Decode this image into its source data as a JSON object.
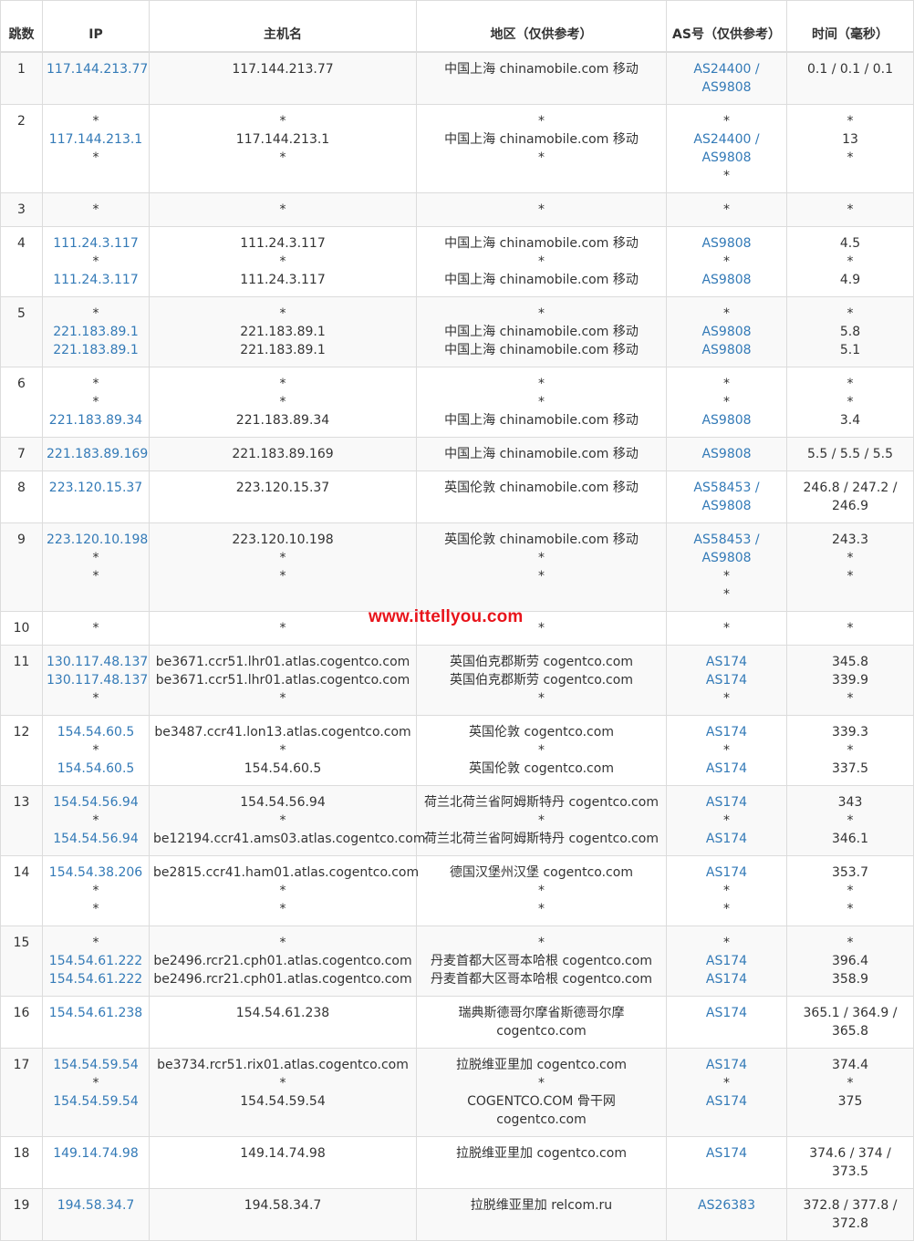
{
  "headers": {
    "hop": "跳数",
    "ip": "IP",
    "host": "主机名",
    "region": "地区（仅供参考）",
    "asn": "AS号（仅供参考）",
    "time": "时间（毫秒）"
  },
  "watermark": "www.ittellyou.com",
  "rows": [
    {
      "hop": "1",
      "ip": [
        "117.144.213.77"
      ],
      "host": [
        "117.144.213.77"
      ],
      "region": [
        "中国上海 chinamobile.com 移动"
      ],
      "asn": [
        "AS24400 /",
        "AS9808"
      ],
      "time": [
        "0.1 / 0.1 / 0.1"
      ]
    },
    {
      "hop": "2",
      "ip": [
        "*",
        "117.144.213.1",
        "*"
      ],
      "host": [
        "*",
        "117.144.213.1",
        "*"
      ],
      "region": [
        "*",
        "中国上海 chinamobile.com 移动",
        "*"
      ],
      "asn": [
        "*",
        "AS24400 /",
        "AS9808",
        "*"
      ],
      "time": [
        "*",
        "13",
        "*"
      ]
    },
    {
      "hop": "3",
      "ip": [
        "*"
      ],
      "host": [
        "*"
      ],
      "region": [
        "*"
      ],
      "asn": [
        "*"
      ],
      "time": [
        "*"
      ]
    },
    {
      "hop": "4",
      "ip": [
        "111.24.3.117",
        "*",
        "111.24.3.117"
      ],
      "host": [
        "111.24.3.117",
        "*",
        "111.24.3.117"
      ],
      "region": [
        "中国上海 chinamobile.com 移动",
        "*",
        "中国上海 chinamobile.com 移动"
      ],
      "asn": [
        "AS9808",
        "*",
        "AS9808"
      ],
      "time": [
        "4.5",
        "*",
        "4.9"
      ]
    },
    {
      "hop": "5",
      "ip": [
        "*",
        "221.183.89.1",
        "221.183.89.1"
      ],
      "host": [
        "*",
        "221.183.89.1",
        "221.183.89.1"
      ],
      "region": [
        "*",
        "中国上海 chinamobile.com 移动",
        "中国上海 chinamobile.com 移动"
      ],
      "asn": [
        "*",
        "AS9808",
        "AS9808"
      ],
      "time": [
        "*",
        "5.8",
        "5.1"
      ]
    },
    {
      "hop": "6",
      "ip": [
        "*",
        "*",
        "221.183.89.34"
      ],
      "host": [
        "*",
        "*",
        "221.183.89.34"
      ],
      "region": [
        "*",
        "*",
        "中国上海 chinamobile.com 移动"
      ],
      "asn": [
        "*",
        "*",
        "AS9808"
      ],
      "time": [
        "*",
        "*",
        "3.4"
      ]
    },
    {
      "hop": "7",
      "ip": [
        "221.183.89.169"
      ],
      "host": [
        "221.183.89.169"
      ],
      "region": [
        "中国上海 chinamobile.com 移动"
      ],
      "asn": [
        "AS9808"
      ],
      "time": [
        "5.5 / 5.5 / 5.5"
      ]
    },
    {
      "hop": "8",
      "ip": [
        "223.120.15.37"
      ],
      "host": [
        "223.120.15.37"
      ],
      "region": [
        "英国伦敦 chinamobile.com 移动"
      ],
      "asn": [
        "AS58453 /",
        "AS9808"
      ],
      "time": [
        "246.8 / 247.2 /",
        "246.9"
      ]
    },
    {
      "hop": "9",
      "ip": [
        "223.120.10.198",
        "*",
        "*"
      ],
      "host": [
        "223.120.10.198",
        "*",
        "*"
      ],
      "region": [
        "英国伦敦 chinamobile.com 移动",
        "*",
        "*"
      ],
      "asn": [
        "AS58453 /",
        "AS9808",
        "*",
        "*"
      ],
      "time": [
        "243.3",
        "*",
        "*"
      ]
    },
    {
      "hop": "10",
      "ip": [
        "*"
      ],
      "host": [
        "*"
      ],
      "region": [
        "*"
      ],
      "asn": [
        "*"
      ],
      "time": [
        "*"
      ]
    },
    {
      "hop": "11",
      "ip": [
        "130.117.48.137",
        "130.117.48.137",
        "*"
      ],
      "host": [
        "be3671.ccr51.lhr01.atlas.cogentco.com",
        "be3671.ccr51.lhr01.atlas.cogentco.com",
        "*"
      ],
      "region": [
        "英国伯克郡斯劳 cogentco.com",
        "英国伯克郡斯劳 cogentco.com",
        "*"
      ],
      "asn": [
        "AS174",
        "AS174",
        "*"
      ],
      "time": [
        "345.8",
        "339.9",
        "*"
      ]
    },
    {
      "hop": "12",
      "ip": [
        "154.54.60.5",
        "*",
        "154.54.60.5"
      ],
      "host": [
        "be3487.ccr41.lon13.atlas.cogentco.com",
        "*",
        "154.54.60.5"
      ],
      "region": [
        "英国伦敦 cogentco.com",
        "*",
        "英国伦敦 cogentco.com"
      ],
      "asn": [
        "AS174",
        "*",
        "AS174"
      ],
      "time": [
        "339.3",
        "*",
        "337.5"
      ]
    },
    {
      "hop": "13",
      "ip": [
        "154.54.56.94",
        "*",
        "154.54.56.94"
      ],
      "host": [
        "154.54.56.94",
        "*",
        "be12194.ccr41.ams03.atlas.cogentco.com"
      ],
      "region": [
        "荷兰北荷兰省阿姆斯特丹 cogentco.com",
        "*",
        "荷兰北荷兰省阿姆斯特丹 cogentco.com"
      ],
      "asn": [
        "AS174",
        "*",
        "AS174"
      ],
      "time": [
        "343",
        "*",
        "346.1"
      ]
    },
    {
      "hop": "14",
      "ip": [
        "154.54.38.206",
        "*",
        "*"
      ],
      "host": [
        "be2815.ccr41.ham01.atlas.cogentco.com",
        "*",
        "*"
      ],
      "region": [
        "德国汉堡州汉堡 cogentco.com",
        "*",
        "*"
      ],
      "asn": [
        "AS174",
        "*",
        "*"
      ],
      "time": [
        "353.7",
        "*",
        "*"
      ]
    },
    {
      "hop": "15",
      "ip": [
        "*",
        "154.54.61.222",
        "154.54.61.222"
      ],
      "host": [
        "*",
        "be2496.rcr21.cph01.atlas.cogentco.com",
        "be2496.rcr21.cph01.atlas.cogentco.com"
      ],
      "region": [
        "*",
        "丹麦首都大区哥本哈根 cogentco.com",
        "丹麦首都大区哥本哈根 cogentco.com"
      ],
      "asn": [
        "*",
        "AS174",
        "AS174"
      ],
      "time": [
        "*",
        "396.4",
        "358.9"
      ]
    },
    {
      "hop": "16",
      "ip": [
        "154.54.61.238"
      ],
      "host": [
        "154.54.61.238"
      ],
      "region": [
        "瑞典斯德哥尔摩省斯德哥尔摩",
        "cogentco.com"
      ],
      "asn": [
        "AS174"
      ],
      "time": [
        "365.1 / 364.9 /",
        "365.8"
      ]
    },
    {
      "hop": "17",
      "ip": [
        "154.54.59.54",
        "*",
        "154.54.59.54"
      ],
      "host": [
        "be3734.rcr51.rix01.atlas.cogentco.com",
        "*",
        "154.54.59.54"
      ],
      "region": [
        "拉脱维亚里加 cogentco.com",
        "*",
        "COGENTCO.COM 骨干网",
        "cogentco.com"
      ],
      "asn": [
        "AS174",
        "*",
        "AS174"
      ],
      "time": [
        "374.4",
        "*",
        "375"
      ]
    },
    {
      "hop": "18",
      "ip": [
        "149.14.74.98"
      ],
      "host": [
        "149.14.74.98"
      ],
      "region": [
        "拉脱维亚里加 cogentco.com"
      ],
      "asn": [
        "AS174"
      ],
      "time": [
        "374.6 / 374 /",
        "373.5"
      ]
    },
    {
      "hop": "19",
      "ip": [
        "194.58.34.7"
      ],
      "host": [
        "194.58.34.7"
      ],
      "region": [
        "拉脱维亚里加 relcom.ru"
      ],
      "asn": [
        "AS26383"
      ],
      "time": [
        "372.8 / 377.8 /",
        "372.8"
      ]
    }
  ]
}
